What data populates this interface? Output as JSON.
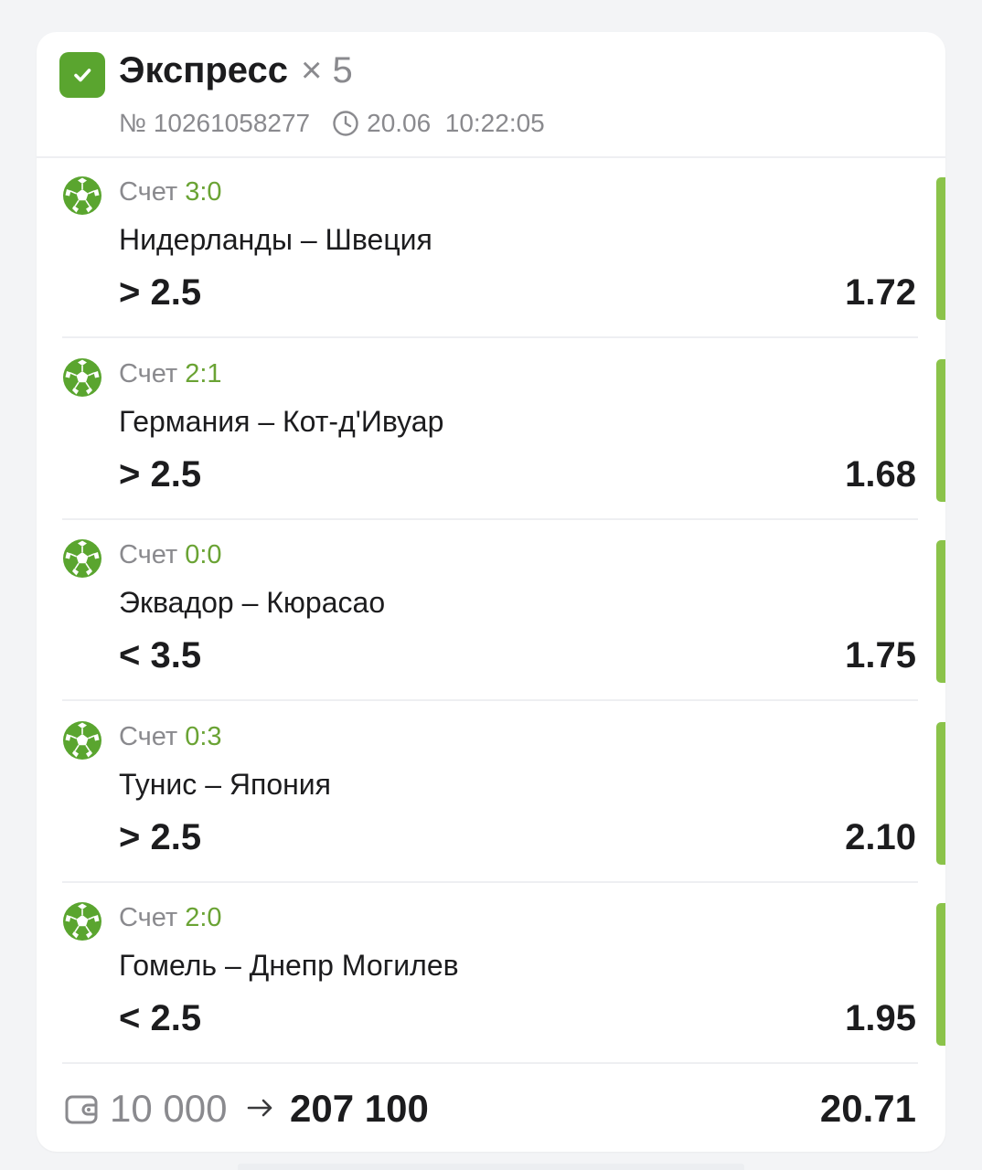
{
  "header": {
    "title": "Экспресс",
    "multiplier": "× 5",
    "bet_number": "№ 10261058277",
    "datetime": "20.06  10:22:05"
  },
  "bets": [
    {
      "score_label": "Счет",
      "score": "3:0",
      "teams": "Нидерланды – Швеция",
      "selection": "> 2.5",
      "odds": "1.72"
    },
    {
      "score_label": "Счет",
      "score": "2:1",
      "teams": "Германия – Кот-д'Ивуар",
      "selection": "> 2.5",
      "odds": "1.68"
    },
    {
      "score_label": "Счет",
      "score": "0:0",
      "teams": "Эквадор – Кюрасао",
      "selection": "< 3.5",
      "odds": "1.75"
    },
    {
      "score_label": "Счет",
      "score": "0:3",
      "teams": "Тунис – Япония",
      "selection": "> 2.5",
      "odds": "2.10"
    },
    {
      "score_label": "Счет",
      "score": "2:0",
      "teams": "Гомель – Днепр Могилев",
      "selection": "< 2.5",
      "odds": "1.95"
    }
  ],
  "footer": {
    "stake": "10 000",
    "payout": "207 100",
    "total_odds": "20.71"
  },
  "icons": {
    "status": "check-icon",
    "sport": "soccer-ball-icon",
    "time": "clock-icon",
    "wallet": "wallet-icon",
    "arrow": "arrow-right-icon"
  },
  "colors": {
    "accent_green": "#5aa52f",
    "score_green": "#6aa334",
    "win_bar": "#8bc34a"
  }
}
